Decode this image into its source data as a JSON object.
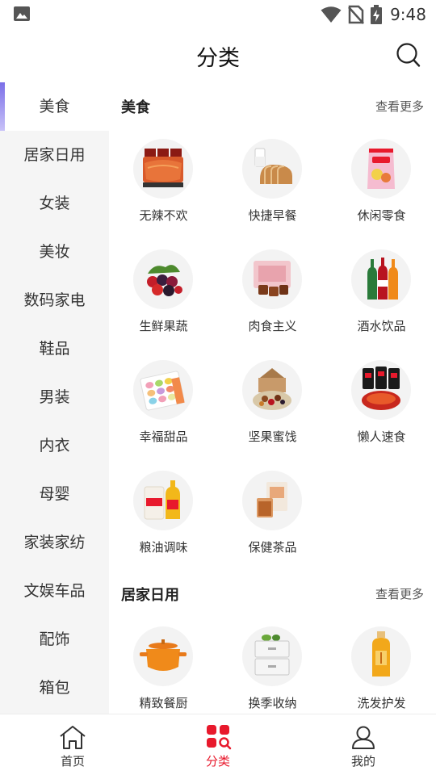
{
  "status_bar": {
    "time": "9:48"
  },
  "header": {
    "title": "分类"
  },
  "sidebar": {
    "items": [
      {
        "label": "美食",
        "active": true
      },
      {
        "label": "居家日用"
      },
      {
        "label": "女装"
      },
      {
        "label": "美妆"
      },
      {
        "label": "数码家电"
      },
      {
        "label": "鞋品"
      },
      {
        "label": "男装"
      },
      {
        "label": "内衣"
      },
      {
        "label": "母婴"
      },
      {
        "label": "家装家纺"
      },
      {
        "label": "文娱车品"
      },
      {
        "label": "配饰"
      },
      {
        "label": "箱包"
      }
    ]
  },
  "sections": [
    {
      "title": "美食",
      "more": "查看更多",
      "items": [
        {
          "label": "无辣不欢",
          "icon": "spicy-snack-icon"
        },
        {
          "label": "快捷早餐",
          "icon": "bread-milk-icon"
        },
        {
          "label": "休闲零食",
          "icon": "chips-bag-icon"
        },
        {
          "label": "生鲜果蔬",
          "icon": "berries-icon"
        },
        {
          "label": "肉食主义",
          "icon": "braised-meat-icon"
        },
        {
          "label": "酒水饮品",
          "icon": "drink-bottles-icon"
        },
        {
          "label": "幸福甜品",
          "icon": "macaron-box-icon"
        },
        {
          "label": "坚果蜜饯",
          "icon": "nuts-box-icon"
        },
        {
          "label": "懒人速食",
          "icon": "instant-noodles-icon"
        },
        {
          "label": "粮油调味",
          "icon": "rice-oil-icon"
        },
        {
          "label": "保健茶品",
          "icon": "tea-box-icon"
        }
      ]
    },
    {
      "title": "居家日用",
      "more": "查看更多",
      "items": [
        {
          "label": "精致餐厨",
          "icon": "orange-pot-icon"
        },
        {
          "label": "换季收纳",
          "icon": "storage-drawer-icon"
        },
        {
          "label": "洗发护发",
          "icon": "shampoo-bottle-icon"
        }
      ]
    }
  ],
  "tabbar": {
    "items": [
      {
        "label": "首页",
        "icon": "home-icon"
      },
      {
        "label": "分类",
        "icon": "category-icon",
        "active": true
      },
      {
        "label": "我的",
        "icon": "profile-icon"
      }
    ]
  },
  "colors": {
    "accent": "#e8192c",
    "sidebar_bg": "#f5f5f5",
    "indicator": "#7b6fe8"
  }
}
